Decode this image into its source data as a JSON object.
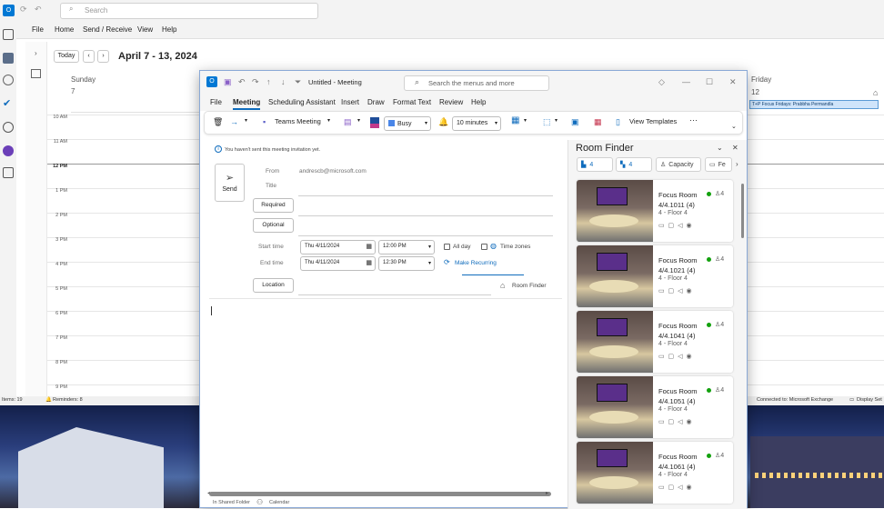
{
  "background_app": {
    "search_placeholder": "Search",
    "menu": [
      "File",
      "Home",
      "Send / Receive",
      "View",
      "Help"
    ],
    "today_label": "Today",
    "date_range": "April 7 - 13, 2024",
    "sunday_label": "Sunday",
    "sunday_date": "7",
    "friday_label": "Friday",
    "friday_date": "12",
    "hours": [
      "10 AM",
      "11 AM",
      "12 PM",
      "1 PM",
      "2 PM",
      "3 PM",
      "4 PM",
      "5 PM",
      "6 PM",
      "7 PM",
      "8 PM",
      "9 PM"
    ],
    "event_title": "T+P Focus Fridays: Prabbha Permandla",
    "status_items": "Items: 19",
    "status_reminders": "Reminders: 8",
    "status_connected": "Connected to: Microsoft Exchange",
    "status_display": "Display Set"
  },
  "meeting": {
    "window_title": "Untitled  -  Meeting",
    "search_placeholder": "Search the menus and more",
    "menu": [
      "File",
      "Meeting",
      "Scheduling Assistant",
      "Insert",
      "Draw",
      "Format Text",
      "Review",
      "Help"
    ],
    "ribbon": {
      "teams_meeting": "Teams Meeting",
      "show_as": "Busy",
      "reminder": "10 minutes",
      "view_templates": "View Templates"
    },
    "info_bar": "You haven't sent this meeting invitation yet.",
    "send_label": "Send",
    "from_label": "From",
    "from_value": "andrescb@microsoft.com",
    "title_label": "Title",
    "required_label": "Required",
    "optional_label": "Optional",
    "start_label": "Start time",
    "start_date": "Thu 4/11/2024",
    "start_time": "12:00 PM",
    "end_label": "End time",
    "end_date": "Thu 4/11/2024",
    "end_time": "12:30 PM",
    "all_day": "All day",
    "time_zones": "Time zones",
    "make_recurring": "Make Recurring",
    "location_label": "Location",
    "room_finder_link": "Room Finder",
    "folder_status": "In Shared Folder",
    "folder_name": "Calendar"
  },
  "room_finder": {
    "title": "Room Finder",
    "filter_buildings": "4",
    "filter_floors": "4",
    "filter_capacity": "Capacity",
    "filter_more": "Fe",
    "rooms": [
      {
        "name": "Focus Room",
        "code": "4/4.1011 (4)",
        "floor": "4 - Floor 4",
        "capacity": "4"
      },
      {
        "name": "Focus Room",
        "code": "4/4.1021 (4)",
        "floor": "4 - Floor 4",
        "capacity": "4"
      },
      {
        "name": "Focus Room",
        "code": "4/4.1041 (4)",
        "floor": "4 - Floor 4",
        "capacity": "4"
      },
      {
        "name": "Focus Room",
        "code": "4/4.1051 (4)",
        "floor": "4 - Floor 4",
        "capacity": "4"
      },
      {
        "name": "Focus Room",
        "code": "4/4.1061 (4)",
        "floor": "4 - Floor 4",
        "capacity": "4"
      }
    ]
  },
  "colors": {
    "accent": "#0f6cbd",
    "available": "#13a10e",
    "outlook_brand": "#0078d4"
  }
}
